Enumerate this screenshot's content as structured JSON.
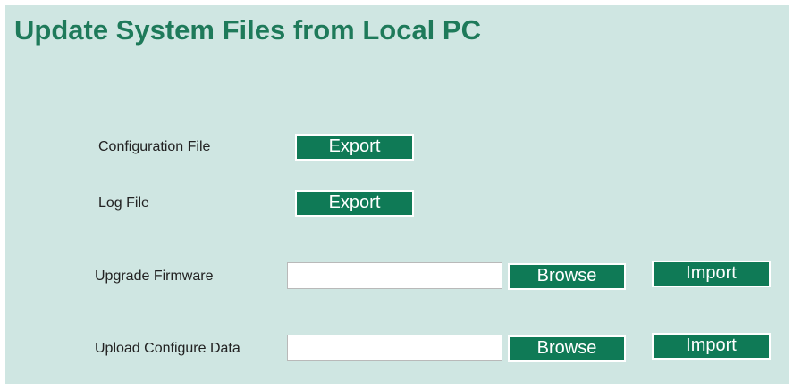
{
  "page": {
    "title": "Update System Files from Local PC"
  },
  "config_file": {
    "label": "Configuration File",
    "export_label": "Export"
  },
  "log_file": {
    "label": "Log File",
    "export_label": "Export"
  },
  "upgrade_firmware": {
    "label": "Upgrade Firmware",
    "file_value": "",
    "browse_label": "Browse",
    "import_label": "Import"
  },
  "upload_config": {
    "label": "Upload Configure Data",
    "file_value": "",
    "browse_label": "Browse",
    "import_label": "Import"
  },
  "colors": {
    "background": "#cfe6e2",
    "title": "#1e7a5a",
    "button": "#0f7a56",
    "button_text": "#ffffff"
  }
}
